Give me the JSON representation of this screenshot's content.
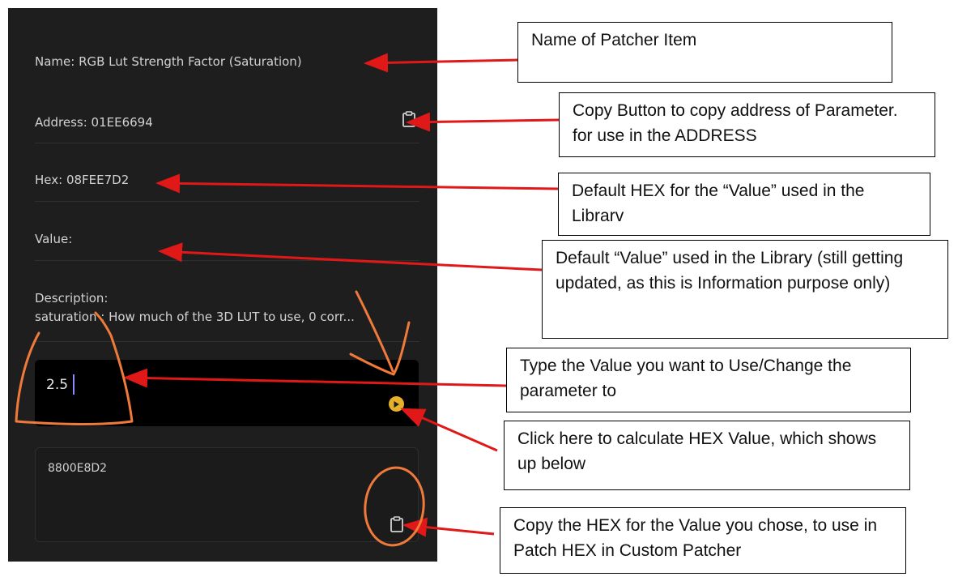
{
  "panel": {
    "name_line": "Name:  RGB Lut Strength Factor (Saturation)",
    "address_line": "Address:  01EE6694",
    "hex_line": "Hex:  08FEE7D2",
    "value_line": "Value:",
    "description_label": "Description:",
    "description_text": "saturation : How much of the 3D LUT to use, 0 corr...",
    "input_value": "2.5",
    "output_hex": "8800E8D2"
  },
  "annotations": {
    "name": "Name of Patcher Item",
    "copy_address": "Copy Button to copy address of Parameter. for use in the ADDRESS",
    "default_hex": "Default HEX for the “Value” used in the Librarv",
    "default_value": "Default “Value” used in the Library (still getting updated, as this is Information purpose only)",
    "type_value": "Type the Value you want to Use/Change the parameter to",
    "calculate": "Click here to calculate HEX Value, which shows up below",
    "copy_hex": "Copy the HEX for the Value you chose, to use in Patch HEX in Custom Patcher"
  },
  "icons": {
    "copy_address": "clipboard-icon",
    "calculate": "play-circle-icon",
    "copy_hex": "clipboard-icon"
  },
  "colors": {
    "panel_background": "#1e1e1e",
    "arrow": "#e01818",
    "marker": "#f07a3a",
    "calc_button": "#e6b128"
  }
}
